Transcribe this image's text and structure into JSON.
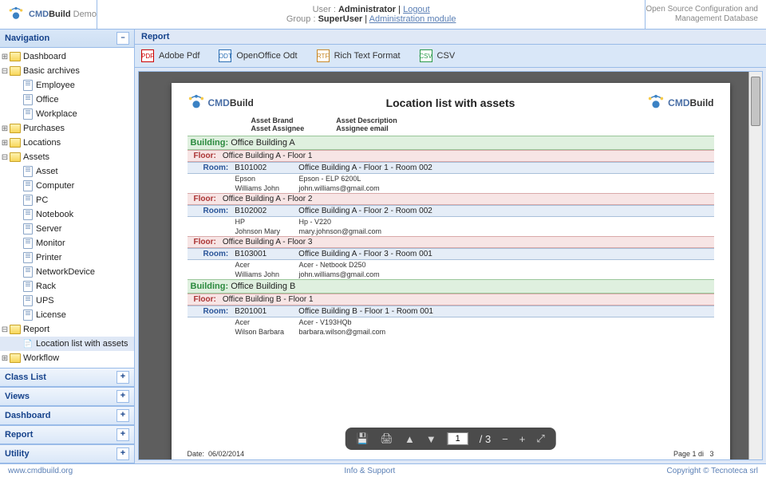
{
  "brand": {
    "name_a": "CMD",
    "name_b": "Build",
    "suffix": "Demo"
  },
  "header": {
    "user_label": "User :",
    "user": "Administrator",
    "logout": "Logout",
    "group_label": "Group :",
    "group": "SuperUser",
    "admin_link": "Administration module"
  },
  "tagline": {
    "l1": "Open Source Configuration and",
    "l2": "Management Database"
  },
  "nav": {
    "title": "Navigation",
    "tree": [
      {
        "label": "Dashboard",
        "icon": "folder",
        "depth": 0,
        "toggle": "plus"
      },
      {
        "label": "Basic archives",
        "icon": "folder",
        "depth": 0,
        "toggle": "minus"
      },
      {
        "label": "Employee",
        "icon": "doc",
        "depth": 1
      },
      {
        "label": "Office",
        "icon": "doc",
        "depth": 1
      },
      {
        "label": "Workplace",
        "icon": "doc",
        "depth": 1
      },
      {
        "label": "Purchases",
        "icon": "folder",
        "depth": 0,
        "toggle": "plus"
      },
      {
        "label": "Locations",
        "icon": "folder",
        "depth": 0,
        "toggle": "plus"
      },
      {
        "label": "Assets",
        "icon": "folder",
        "depth": 0,
        "toggle": "minus"
      },
      {
        "label": "Asset",
        "icon": "doc",
        "depth": 1
      },
      {
        "label": "Computer",
        "icon": "doc",
        "depth": 1
      },
      {
        "label": "PC",
        "icon": "doc",
        "depth": 1
      },
      {
        "label": "Notebook",
        "icon": "doc",
        "depth": 1
      },
      {
        "label": "Server",
        "icon": "doc",
        "depth": 1
      },
      {
        "label": "Monitor",
        "icon": "doc",
        "depth": 1
      },
      {
        "label": "Printer",
        "icon": "doc",
        "depth": 1
      },
      {
        "label": "NetworkDevice",
        "icon": "doc",
        "depth": 1
      },
      {
        "label": "Rack",
        "icon": "doc",
        "depth": 1
      },
      {
        "label": "UPS",
        "icon": "doc",
        "depth": 1
      },
      {
        "label": "License",
        "icon": "doc",
        "depth": 1
      },
      {
        "label": "Report",
        "icon": "folder",
        "depth": 0,
        "toggle": "minus"
      },
      {
        "label": "Location list with assets",
        "icon": "pdf",
        "depth": 1,
        "selected": true
      },
      {
        "label": "Workflow",
        "icon": "folder",
        "depth": 0,
        "toggle": "plus"
      }
    ],
    "accordion": [
      "Class List",
      "Views",
      "Dashboard",
      "Report",
      "Utility"
    ]
  },
  "content": {
    "title": "Report",
    "toolbar": [
      {
        "icon": "PDF",
        "label": "Adobe Pdf",
        "color": "#c00"
      },
      {
        "icon": "ODT",
        "label": "OpenOffice Odt",
        "color": "#2b6fb5"
      },
      {
        "icon": "RTF",
        "label": "Rich Text Format",
        "color": "#c98a2b"
      },
      {
        "icon": "CSV",
        "label": "CSV",
        "color": "#2b9a4a"
      }
    ]
  },
  "report": {
    "title": "Location list with assets",
    "col_headers": {
      "a1": "Asset Brand",
      "a2": "Asset Description",
      "b1": "Asset Assignee",
      "b2": "Assignee email"
    },
    "building_label": "Building:",
    "floor_label": "Floor:",
    "room_label": "Room:",
    "buildings": [
      {
        "name": "Office Building A",
        "floors": [
          {
            "name": "Office Building A - Floor 1",
            "rooms": [
              {
                "code": "B101002",
                "name": "Office Building A - Floor 1 - Room 002",
                "assets": [
                  {
                    "brand": "Epson",
                    "desc": "Epson - ELP 6200L"
                  },
                  {
                    "brand": "Williams John",
                    "desc": "john.williams@gmail.com"
                  }
                ]
              }
            ]
          },
          {
            "name": "Office Building A - Floor 2",
            "rooms": [
              {
                "code": "B102002",
                "name": "Office Building A - Floor 2 - Room 002",
                "assets": [
                  {
                    "brand": "HP",
                    "desc": "Hp - V220"
                  },
                  {
                    "brand": "Johnson Mary",
                    "desc": "mary.johnson@gmail.com"
                  }
                ]
              }
            ]
          },
          {
            "name": "Office Building A - Floor 3",
            "rooms": [
              {
                "code": "B103001",
                "name": "Office Building A - Floor 3 - Room 001",
                "assets": [
                  {
                    "brand": "Acer",
                    "desc": "Acer - Netbook D250"
                  },
                  {
                    "brand": "Williams John",
                    "desc": "john.williams@gmail.com"
                  }
                ]
              }
            ]
          }
        ]
      },
      {
        "name": "Office Building B",
        "floors": [
          {
            "name": "Office Building B - Floor 1",
            "rooms": [
              {
                "code": "B201001",
                "name": "Office Building B - Floor 1 - Room 001",
                "assets": [
                  {
                    "brand": "Acer",
                    "desc": "Acer - V193HQb"
                  },
                  {
                    "brand": "Wilson Barbara",
                    "desc": "barbara.wilson@gmail.com"
                  }
                ]
              }
            ]
          }
        ]
      }
    ],
    "date_label": "Date:",
    "date": "06/02/2014",
    "page_label": "Page 1 di",
    "total_pages": "3"
  },
  "pdfbar": {
    "current": "1",
    "sep": "/",
    "total": "3"
  },
  "footer": {
    "left": "www.cmdbuild.org",
    "center": "Info & Support",
    "right": "Copyright © Tecnoteca srl"
  }
}
